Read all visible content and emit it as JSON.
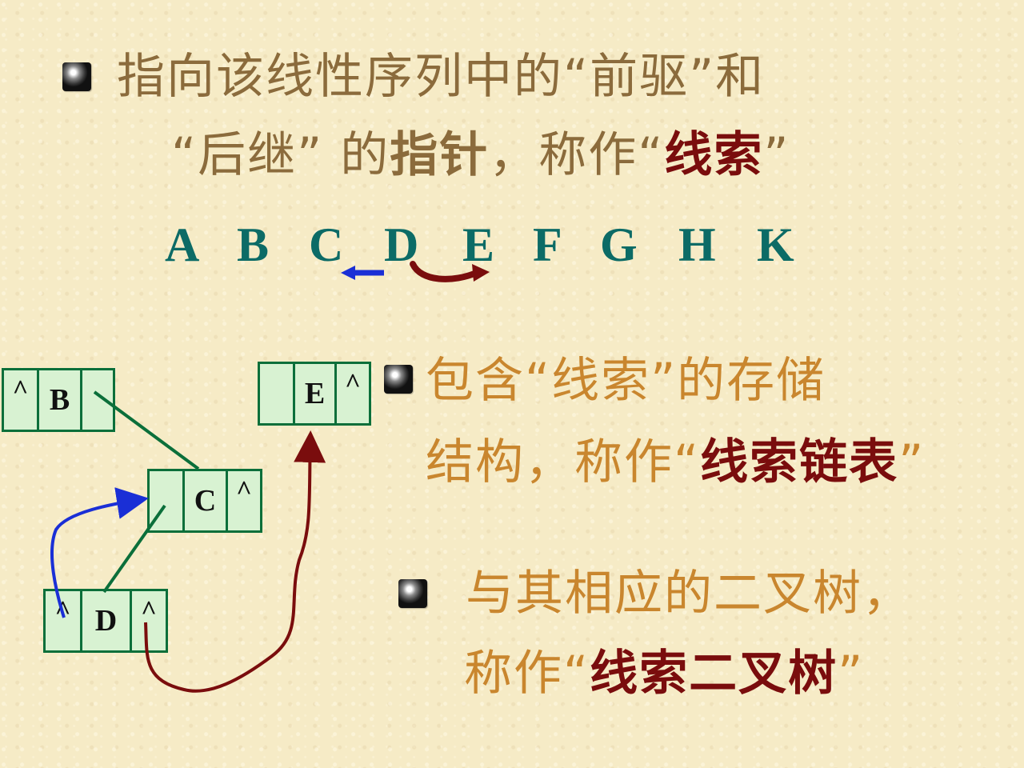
{
  "bullet1": {
    "line1": "指向该线性序列中的“前驱”和",
    "line2_pre": "“后继”",
    "line2_mid1": " 的",
    "line2_bold": "指针",
    "line2_mid2": "，称作“",
    "line2_red": "线索",
    "line2_end": "”"
  },
  "sequence": [
    "A",
    "B",
    "C",
    "D",
    "E",
    "F",
    "G",
    "H",
    "K"
  ],
  "nodes": {
    "b": {
      "left": "^",
      "data": "B",
      "right": ""
    },
    "e": {
      "left": "",
      "data": "E",
      "right": "^"
    },
    "c": {
      "left": "",
      "data": "C",
      "right": "^"
    },
    "d": {
      "left": "^",
      "data": "D",
      "right": "^"
    }
  },
  "bullet2": {
    "line1": "包含“线索”的存储",
    "line2_pre": "结构，称作“",
    "line2_red": "线索链表",
    "line2_end": "”"
  },
  "bullet3": {
    "line1": "与其相应的二叉树，",
    "line2_pre": "称作“",
    "line2_red": "线索二叉树",
    "line2_end": "”"
  },
  "colors": {
    "background": "#f6ebc6",
    "text_brown": "#8b6b3c",
    "text_orange": "#c9862e",
    "emphasis_red": "#7a0d0d",
    "sequence_teal": "#0c6b66",
    "node_border": "#0b6f3a",
    "node_fill": "#d8f2d2",
    "predecessor_arrow": "#1a2fd6",
    "successor_arrow": "#7a0d0d"
  }
}
